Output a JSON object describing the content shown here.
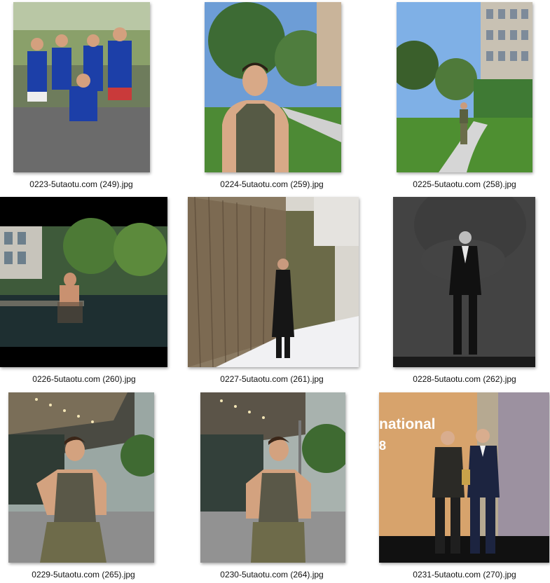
{
  "files": [
    {
      "name": "0223-5utaotu.com (249).jpg",
      "scene": "group-runners-street"
    },
    {
      "name": "0224-5utaotu.com (259).jpg",
      "scene": "man-tanktop-park"
    },
    {
      "name": "0225-5utaotu.com (258).jpg",
      "scene": "man-walking-garden-path"
    },
    {
      "name": "0226-5utaotu.com (260).jpg",
      "scene": "man-in-pool-letterbox"
    },
    {
      "name": "0227-5utaotu.com (261).jpg",
      "scene": "man-black-coat-snow"
    },
    {
      "name": "0228-5utaotu.com (262).jpg",
      "scene": "man-tuxedo-stage-bw"
    },
    {
      "name": "0229-5utaotu.com (265).jpg",
      "scene": "man-tanktop-hand-on-head"
    },
    {
      "name": "0230-5utaotu.com (264).jpg",
      "scene": "man-tanktop-walking"
    },
    {
      "name": "0231-5utaotu.com (270).jpg",
      "scene": "award-ceremony-two-men"
    }
  ],
  "stage_text": {
    "banner": "national",
    "digit": "8"
  }
}
